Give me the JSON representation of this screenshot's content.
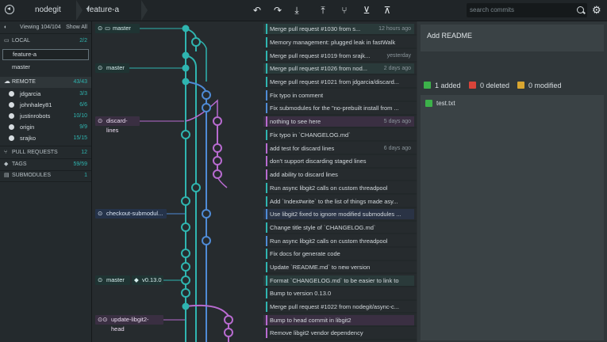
{
  "topbar": {
    "repo": "nodegit",
    "branch": "feature-a",
    "search_placeholder": "search commits"
  },
  "sidebar": {
    "viewing": "Viewing 104/104",
    "show_all": "Show All",
    "local_label": "LOCAL",
    "local_count": "2/2",
    "local_branches": [
      "feature-a",
      "master"
    ],
    "remote_label": "REMOTE",
    "remote_count": "43/43",
    "remotes": [
      {
        "name": "jdgarcia",
        "count": "3/3"
      },
      {
        "name": "johnhaley81",
        "count": "6/6"
      },
      {
        "name": "justinrobots",
        "count": "10/10"
      },
      {
        "name": "origin",
        "count": "9/9"
      },
      {
        "name": "srajko",
        "count": "15/15"
      }
    ],
    "pull_requests_label": "PULL REQUESTS",
    "pull_requests_count": "12",
    "tags_label": "TAGS",
    "tags_count": "59/59",
    "submodules_label": "SUBMODULES",
    "submodules_count": "1"
  },
  "graph": {
    "refs": [
      {
        "label": "master",
        "color": "#2fb5b0"
      },
      {
        "label": "master",
        "color": "#2fb5b0"
      },
      {
        "label": "discard-lines",
        "color": "#b86bd0"
      },
      {
        "label": "checkout-submodul...",
        "color": "#4f8bd6"
      },
      {
        "label": "master",
        "color": "#2fb5b0"
      },
      {
        "label": "v0.13.0",
        "color": "#2fb5b0"
      },
      {
        "label": "update-libgit2-head",
        "color": "#b86bd0"
      }
    ],
    "commits": [
      {
        "message": "Merge pull request #1030 from s...",
        "time": "12 hours ago"
      },
      {
        "message": "Memory management: plugged leak in fastWalk",
        "time": ""
      },
      {
        "message": "Merge pull request #1019 from srajk...",
        "time": "yesterday"
      },
      {
        "message": "Merge pull request #1026 from nod...",
        "time": "2 days ago"
      },
      {
        "message": "Merge pull request #1021 from jdgarcia/discard...",
        "time": ""
      },
      {
        "message": "Fix typo in comment",
        "time": ""
      },
      {
        "message": "Fix submodules for the \"no-prebuilt install from ...",
        "time": ""
      },
      {
        "message": "nothing to see here",
        "time": "5 days ago"
      },
      {
        "message": "Fix typo in `CHANGELOG.md`",
        "time": ""
      },
      {
        "message": "add test for discard lines",
        "time": "6 days ago"
      },
      {
        "message": "don't support discarding staged lines",
        "time": ""
      },
      {
        "message": "add ability to discard lines",
        "time": ""
      },
      {
        "message": "Run async libgit2 calls on custom threadpool",
        "time": ""
      },
      {
        "message": "Add `Index#write` to the list of things made asy...",
        "time": ""
      },
      {
        "message": "Use libgit2 fixed to ignore modified submodules ...",
        "time": ""
      },
      {
        "message": "Change title style of `CHANGELOG.md`",
        "time": ""
      },
      {
        "message": "Run async libgit2 calls on custom threadpool",
        "time": ""
      },
      {
        "message": "Fix docs for generate code",
        "time": ""
      },
      {
        "message": "Update `README.md` to new version",
        "time": ""
      },
      {
        "message": "Format `CHANGELOG.md` to be easier to link to",
        "time": ""
      },
      {
        "message": "Bump to version 0.13.0",
        "time": ""
      },
      {
        "message": "Merge pull request #1022 from nodegit/async-c...",
        "time": ""
      },
      {
        "message": "Bump to head commit in libgit2",
        "time": ""
      },
      {
        "message": "Remove libgit2 vendor dependency",
        "time": ""
      }
    ]
  },
  "detail": {
    "title": "Add README",
    "added": "1 added",
    "deleted": "0 deleted",
    "modified": "0 modified",
    "files": [
      "test.txt"
    ]
  },
  "colors": {
    "teal": "#2fb5b0",
    "purple": "#b86bd0",
    "blue": "#4f8bd6",
    "added": "#3cb24a",
    "deleted": "#d9443a",
    "modified": "#d9a630"
  }
}
